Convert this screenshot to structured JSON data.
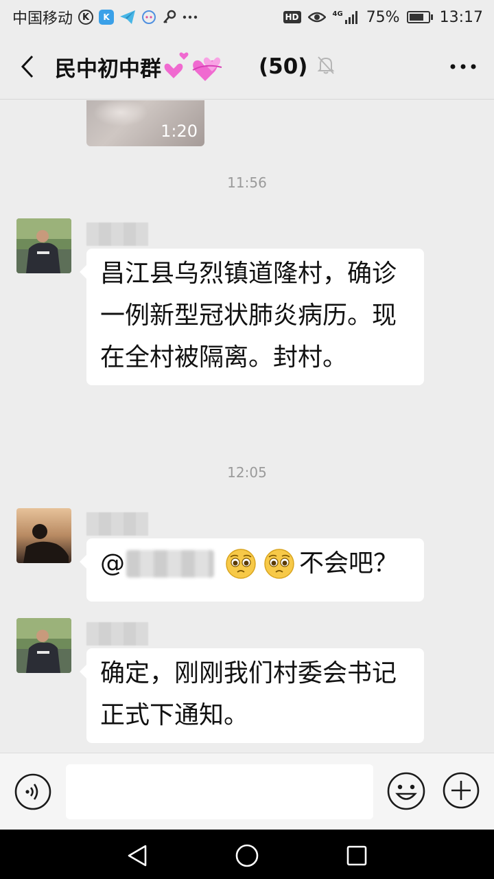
{
  "status_bar": {
    "carrier": "中国移动",
    "network": "4G",
    "battery_percent": "75%",
    "battery_level": 0.75,
    "time": "13:17",
    "hd_label": "HD",
    "k_label": "K"
  },
  "header": {
    "title": "民中初中群",
    "member_count": "(50)"
  },
  "messages": [
    {
      "type": "video",
      "duration": "1:20"
    },
    {
      "type": "time",
      "text": "11:56"
    },
    {
      "type": "text",
      "text": "昌江县乌烈镇道隆村，确诊一例新型冠状肺炎病历。现在全村被隔离。封村。"
    },
    {
      "type": "time",
      "text": "12:05"
    },
    {
      "type": "mention",
      "prefix": "@",
      "trail": "不会吧？"
    },
    {
      "type": "text",
      "text": "确定，刚刚我们村委会书记正式下通知。"
    }
  ],
  "input": {
    "value": ""
  },
  "colors": {
    "background": "#ededed",
    "bubble": "#ffffff",
    "heart": "#f06ad0"
  }
}
